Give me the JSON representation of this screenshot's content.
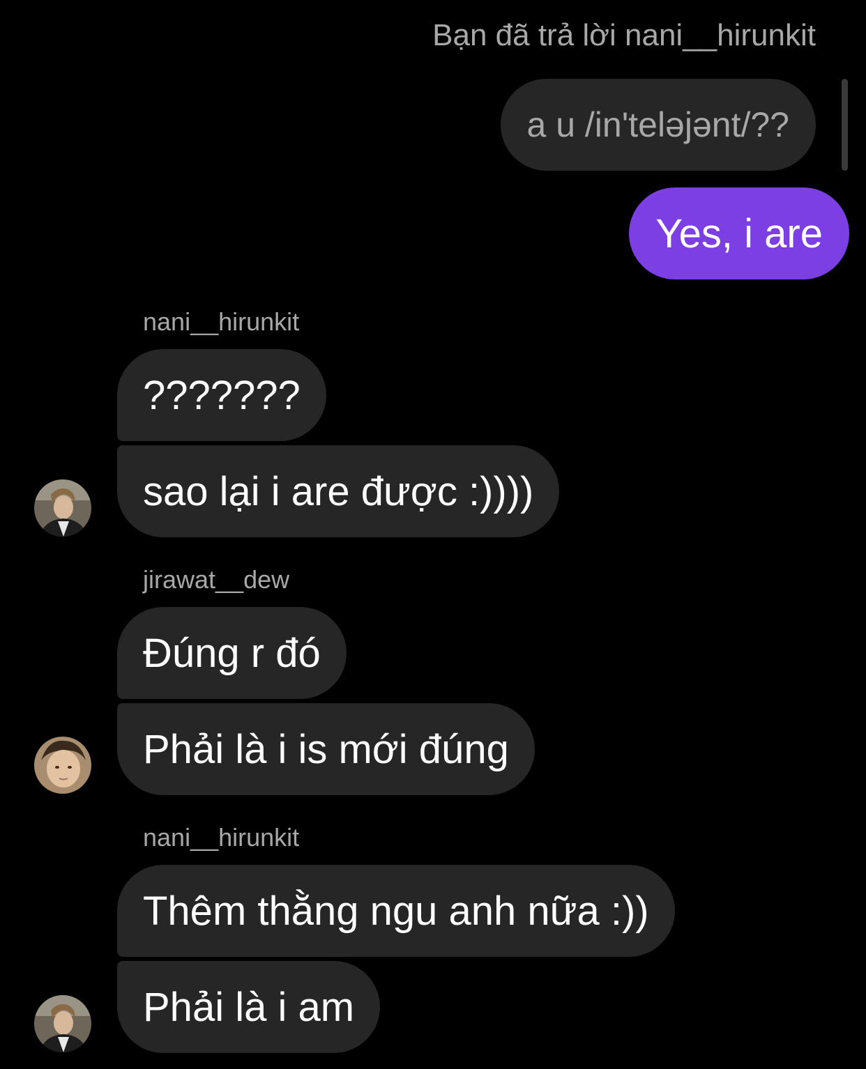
{
  "reply_note": "Bạn đã trả lời nani__hirunkit",
  "quoted_message": "a u /in'teləjənt/??",
  "my_reply": "Yes, i are",
  "groups": [
    {
      "sender": "nani__hirunkit",
      "messages": [
        "???????",
        "sao lại i are được :))))"
      ]
    },
    {
      "sender": "jirawat__dew",
      "messages": [
        "Đúng r đó",
        "Phải là i is mới đúng"
      ]
    },
    {
      "sender": "nani__hirunkit",
      "messages": [
        "Thêm thằng ngu anh nữa :))",
        "Phải là i am"
      ]
    }
  ],
  "colors": {
    "background": "#000000",
    "bubble_incoming": "#262626",
    "bubble_outgoing": "#7b3fe4",
    "secondary_text": "#a8a8a8"
  }
}
